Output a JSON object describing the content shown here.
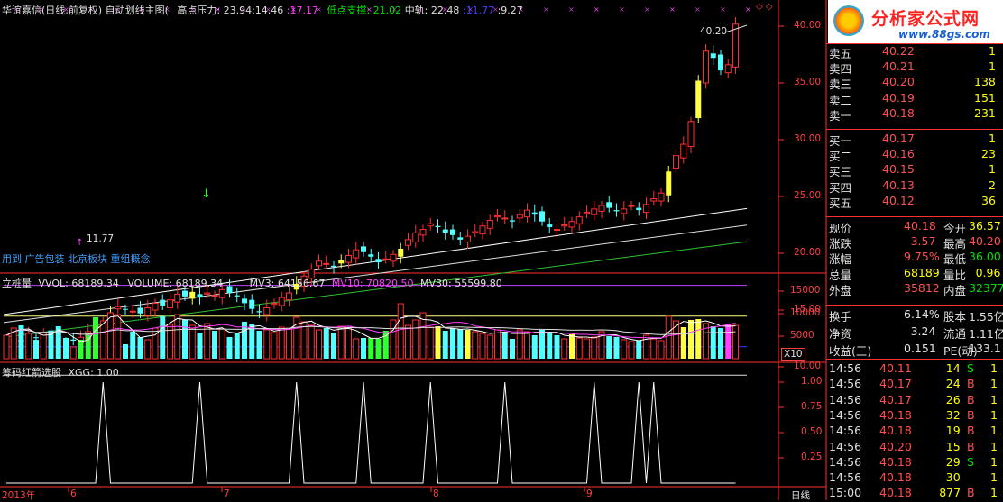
{
  "header": {
    "title": "华谊嘉信(日线,前复权) 自动划线主图(",
    "high_label": "高点压力: 23.94",
    "sep1": ":14.46",
    "purple_val": ":17.17",
    "low_label": "低点支撑: 21.02",
    "mid_label": "中轨: 22.48",
    "blue_val": ":11.77",
    "last_val": ":9.27"
  },
  "main_chart": {
    "peak_label": "40.20",
    "low_label": "11.77",
    "price_ticks": [
      "40.00",
      "35.00",
      "30.00",
      "25.00",
      "20.00",
      "15.00",
      "10.00"
    ],
    "concept_tags": "用到 广告包装 北京板块 重组概念"
  },
  "volume": {
    "title": "立桩量",
    "vvol": "VVOL: 68189.34",
    "volume_val": "VOLUME: 68189.34",
    "mv3": "MV3: 64156.67",
    "mv10": "MV10: 70820.50",
    "mv30": "MV30: 55599.80",
    "ticks": [
      "15000",
      "10000",
      "5000"
    ],
    "unit": "X10"
  },
  "indicator": {
    "title": "筹码红箭选股",
    "xgg": "XGG: 1.00",
    "ticks": [
      "1.00",
      "0.75",
      "0.50",
      "0.25"
    ]
  },
  "time_axis": {
    "year": "2013年",
    "months": [
      "6",
      "7",
      "8",
      "9"
    ],
    "period": "日线"
  },
  "logo": {
    "name": "分析家公式网",
    "url": "www.88gs.com"
  },
  "order_book": {
    "sells": [
      {
        "label": "卖五",
        "price": "40.22",
        "vol": "1"
      },
      {
        "label": "卖四",
        "price": "40.21",
        "vol": "1"
      },
      {
        "label": "卖三",
        "price": "40.20",
        "vol": "138"
      },
      {
        "label": "卖二",
        "price": "40.19",
        "vol": "151"
      },
      {
        "label": "卖一",
        "price": "40.18",
        "vol": "231"
      }
    ],
    "buys": [
      {
        "label": "买一",
        "price": "40.17",
        "vol": "1"
      },
      {
        "label": "买二",
        "price": "40.16",
        "vol": "23"
      },
      {
        "label": "买三",
        "price": "40.15",
        "vol": "1"
      },
      {
        "label": "买四",
        "price": "40.13",
        "vol": "2"
      },
      {
        "label": "买五",
        "price": "40.12",
        "vol": "36"
      }
    ]
  },
  "quote": [
    {
      "l1": "现价",
      "v1": "40.18",
      "l2": "今开",
      "v2": "36.57"
    },
    {
      "l1": "涨跌",
      "v1": "3.57",
      "l2": "最高",
      "v2": "40.20"
    },
    {
      "l1": "涨幅",
      "v1": "9.75%",
      "l2": "最低",
      "v2": "36.00"
    },
    {
      "l1": "总量",
      "v1": "68189",
      "l2": "量比",
      "v2": "0.96"
    },
    {
      "l1": "外盘",
      "v1": "35812",
      "l2": "内盘",
      "v2": "32377"
    }
  ],
  "stats": [
    {
      "l1": "换手",
      "v1": "6.14%",
      "l2": "股本",
      "v2": "1.55亿"
    },
    {
      "l1": "净资",
      "v1": "3.24",
      "l2": "流通",
      "v2": "1.11亿"
    },
    {
      "l1": "收益(三)",
      "v1": "0.151",
      "l2": "PE(动)",
      "v2": "133.1"
    }
  ],
  "ticks": [
    {
      "time": "14:56",
      "price": "40.11",
      "vol": "14",
      "side": "S"
    },
    {
      "time": "14:56",
      "price": "40.17",
      "vol": "24",
      "side": "B"
    },
    {
      "time": "14:56",
      "price": "40.17",
      "vol": "26",
      "side": "B"
    },
    {
      "time": "14:56",
      "price": "40.18",
      "vol": "32",
      "side": "B"
    },
    {
      "time": "14:56",
      "price": "40.18",
      "vol": "19",
      "side": "B"
    },
    {
      "time": "14:56",
      "price": "40.20",
      "vol": "15",
      "side": "B"
    },
    {
      "time": "14:56",
      "price": "40.18",
      "vol": "29",
      "side": "S"
    },
    {
      "time": "14:56",
      "price": "40.18",
      "vol": "30",
      "side": ""
    },
    {
      "time": "15:00",
      "price": "40.18",
      "vol": "877",
      "side": "B"
    }
  ]
}
